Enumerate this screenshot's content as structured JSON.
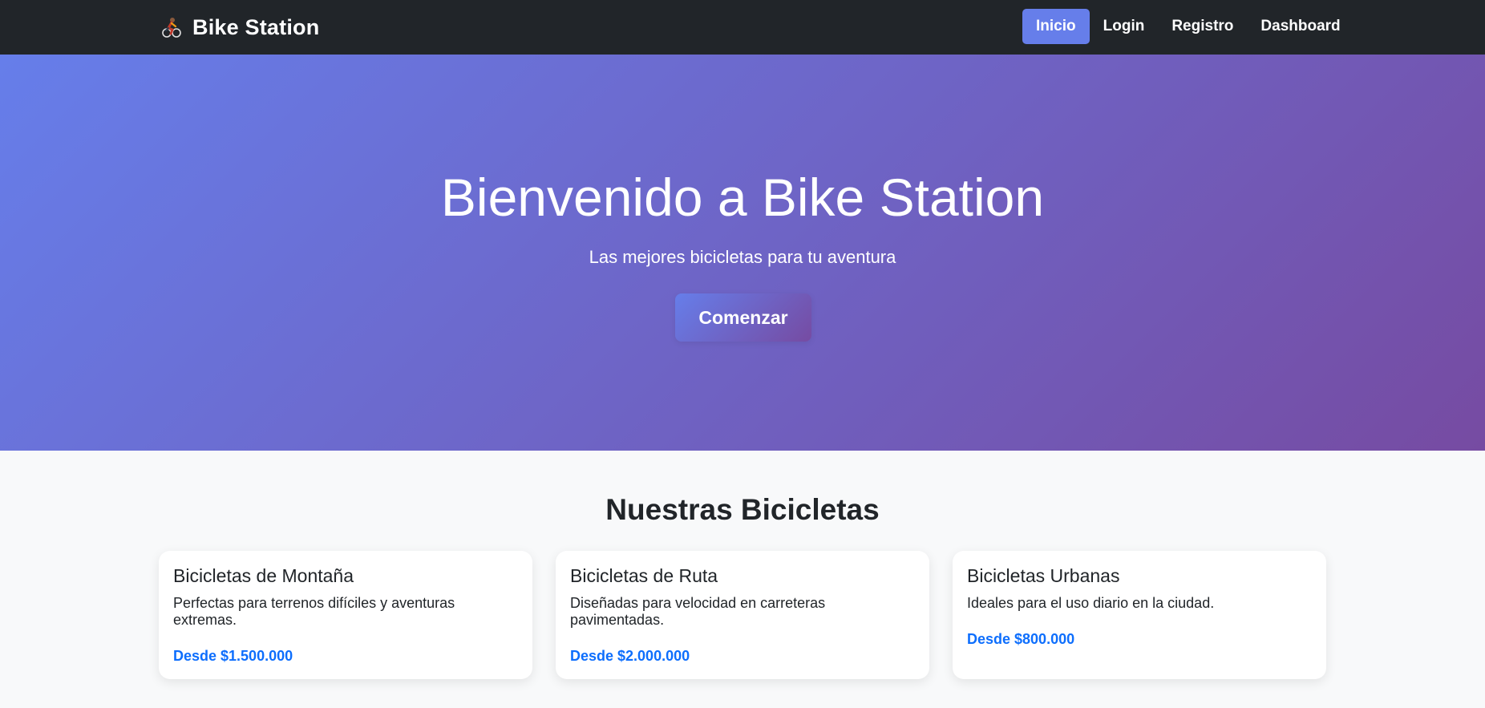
{
  "nav": {
    "brand": "Bike Station",
    "brand_icon": "cyclist-icon",
    "links": [
      {
        "label": "Inicio",
        "active": true
      },
      {
        "label": "Login"
      },
      {
        "label": "Registro"
      },
      {
        "label": "Dashboard"
      }
    ]
  },
  "hero": {
    "title": "Bienvenido a Bike Station",
    "subtitle": "Las mejores bicicletas para tu aventura",
    "cta": "Comenzar"
  },
  "section": {
    "title": "Nuestras Bicicletas"
  },
  "cards": [
    {
      "title": "Bicicletas de Montaña",
      "description": "Perfectas para terrenos difíciles y aventuras extremas.",
      "price": "Desde $1.500.000"
    },
    {
      "title": "Bicicletas de Ruta",
      "description": "Diseñadas para velocidad en carreteras pavimentadas.",
      "price": "Desde $2.000.000"
    },
    {
      "title": "Bicicletas Urbanas",
      "description": "Ideales para el uso diario en la ciudad.",
      "price": "Desde $800.000"
    }
  ],
  "colors": {
    "navbar": "#212529",
    "accent": "#667eea",
    "gradient_end": "#764ba2",
    "price": "#0d6efd",
    "background": "#f8f9fa"
  }
}
